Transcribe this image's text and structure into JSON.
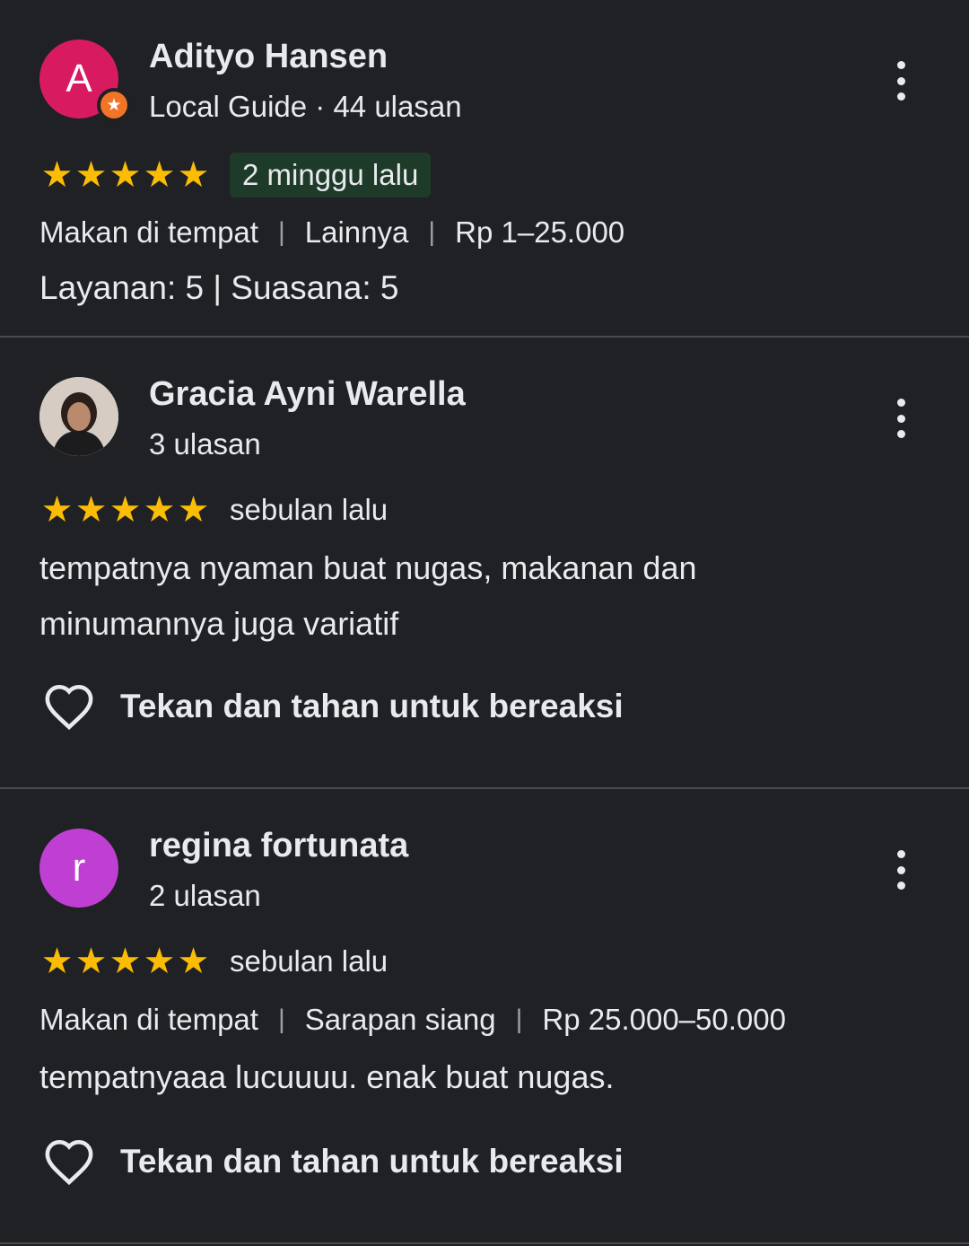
{
  "colors": {
    "background": "#202124",
    "divider": "#4a4b4e",
    "star": "#fbbc04",
    "text": "#e8eaed",
    "date_highlight_bg": "#1e3b2a",
    "local_guide_badge": "#f27527"
  },
  "reviews": [
    {
      "avatar_letter": "A",
      "avatar_color": "#d81b60",
      "name": "Adityo Hansen",
      "subline": "Local Guide · 44 ulasan",
      "stars": 5,
      "date": "2 minggu lalu",
      "meta": {
        "dining": "Makan di tempat",
        "meal": "Lainnya",
        "price": "Rp 1–25.000"
      },
      "sub_ratings": "Layanan: 5 | Suasana: 5"
    },
    {
      "avatar_icon": "profile-photo",
      "name": "Gracia Ayni Warella",
      "subline": "3 ulasan",
      "stars": 5,
      "date": "sebulan lalu",
      "text": "tempatnya nyaman buat nugas, makanan dan minumannya juga variatif",
      "react_label": "Tekan dan tahan untuk bereaksi"
    },
    {
      "avatar_letter": "r",
      "avatar_color": "#c03fd3",
      "name": "regina fortunata",
      "subline": "2 ulasan",
      "stars": 5,
      "date": "sebulan lalu",
      "meta": {
        "dining": "Makan di tempat",
        "meal": "Sarapan siang",
        "price": "Rp 25.000–50.000"
      },
      "text": "tempatnyaaa lucuuuu. enak buat nugas.",
      "react_label": "Tekan dan tahan untuk bereaksi"
    }
  ],
  "icons": {
    "star": "star-icon",
    "more": "more-vert-icon",
    "heart": "heart-outline-icon",
    "local_guide": "local-guide-star-icon"
  }
}
